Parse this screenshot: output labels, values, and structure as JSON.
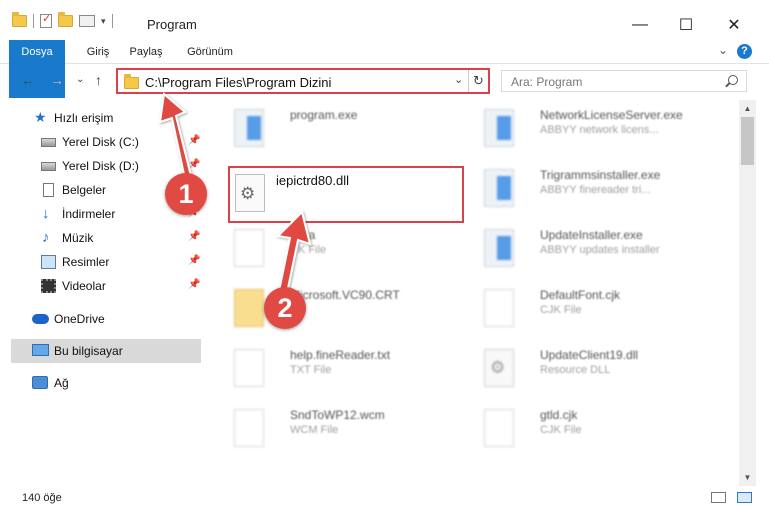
{
  "window": {
    "title": "Program",
    "minimize": "—",
    "maximize": "☐",
    "close": "✕"
  },
  "ribbon": {
    "tabs": [
      "Dosya",
      "Giriş",
      "Paylaş",
      "Görünüm"
    ],
    "collapse": "⌄",
    "help": "?"
  },
  "nav": {
    "back": "←",
    "forward": "→",
    "recent": "⌄",
    "up": "↑"
  },
  "address": {
    "path": "C:\\Program Files\\Program Dizini",
    "dropdown": "⌄",
    "refresh": "↻"
  },
  "search": {
    "placeholder": "Ara: Program"
  },
  "sidebar": {
    "items": [
      {
        "label": "Hızlı erişim",
        "icon": "star-icon"
      },
      {
        "label": "Yerel Disk (C:)",
        "icon": "disk-icon",
        "pinned": true
      },
      {
        "label": "Yerel Disk (D:)",
        "icon": "disk-icon",
        "pinned": true
      },
      {
        "label": "Belgeler",
        "icon": "document-icon",
        "pinned": true
      },
      {
        "label": "İndirmeler",
        "icon": "download-icon",
        "pinned": true
      },
      {
        "label": "Müzik",
        "icon": "music-icon",
        "pinned": true
      },
      {
        "label": "Resimler",
        "icon": "pictures-icon",
        "pinned": true
      },
      {
        "label": "Videolar",
        "icon": "video-icon",
        "pinned": true
      },
      {
        "label": "OneDrive",
        "icon": "cloud-icon"
      },
      {
        "label": "Bu bilgisayar",
        "icon": "computer-icon",
        "selected": true
      },
      {
        "label": "Ağ",
        "icon": "network-icon"
      }
    ],
    "pin_glyph": "📌"
  },
  "files": {
    "left": [
      {
        "name": "program.exe",
        "desc": "",
        "icon": "exe-icon"
      },
      {
        "name": "",
        "desc": "",
        "icon": "document-icon"
      },
      {
        "name": "Data",
        "desc": "CK File",
        "icon": "document-icon"
      },
      {
        "name": "Microsoft.VC90.CRT",
        "desc": "",
        "icon": "folder-icon"
      },
      {
        "name": "help.fineReader.txt",
        "desc": "TXT File",
        "icon": "document-icon"
      },
      {
        "name": "SndToWP12.wcm",
        "desc": "WCM File",
        "icon": "document-icon"
      }
    ],
    "right": [
      {
        "name": "NetworkLicenseServer.exe",
        "desc": "ABBYY network licens...",
        "icon": "exe-icon"
      },
      {
        "name": "Trigrammsinstaller.exe",
        "desc": "ABBYY finereader tri...",
        "icon": "exe-icon"
      },
      {
        "name": "UpdateInstaller.exe",
        "desc": "ABBYY updates installer",
        "icon": "exe-icon"
      },
      {
        "name": "DefaultFont.cjk",
        "desc": "CJK File",
        "icon": "document-icon"
      },
      {
        "name": "UpdateClient19.dll",
        "desc": "Resource DLL",
        "icon": "gear-icon"
      },
      {
        "name": "gtld.cjk",
        "desc": "CJK File",
        "icon": "document-icon"
      }
    ],
    "highlighted": {
      "name": "iepictrd80.dll",
      "icon": "gear-icon"
    }
  },
  "status": {
    "count": "140 öğe"
  },
  "markers": {
    "one": "1",
    "two": "2"
  },
  "colors": {
    "accent": "#1979ca",
    "highlight_border": "#d9424a",
    "marker": "#e04a43"
  }
}
